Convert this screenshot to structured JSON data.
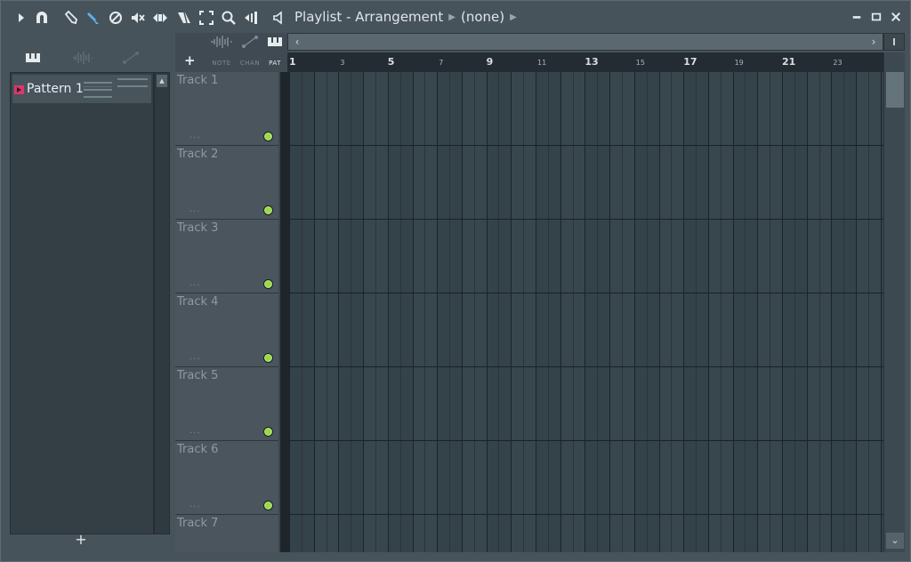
{
  "window": {
    "title": "Playlist - Arrangement",
    "context": "(none)"
  },
  "toolbar_icons": [
    "play-arrow-icon",
    "magnet-icon",
    "pencil-icon",
    "paint-brush-icon",
    "delete-icon",
    "mute-icon",
    "slip-icon",
    "slice-icon",
    "select-icon",
    "zoom-icon",
    "playback-icon",
    "speaker-icon"
  ],
  "patterns": {
    "items": [
      {
        "label": "Pattern 1",
        "color": "#e0356a"
      }
    ],
    "add_label": "+"
  },
  "playlist": {
    "add_label": "+",
    "modes": [
      {
        "label": "NOTE",
        "icon": "waveform-icon",
        "active": false
      },
      {
        "label": "CHAN",
        "icon": "automation-icon",
        "active": false
      },
      {
        "label": "PAT",
        "icon": "piano-icon",
        "active": true
      }
    ],
    "scroll_left": "‹",
    "scroll_right": "›",
    "timeline": {
      "major": [
        "1",
        "5",
        "9",
        "13",
        "17",
        "21"
      ],
      "minor": [
        "3",
        "7",
        "11",
        "15",
        "19",
        "23"
      ]
    },
    "tracks": [
      {
        "name": "Track 1",
        "dots": "..."
      },
      {
        "name": "Track 2",
        "dots": "..."
      },
      {
        "name": "Track 3",
        "dots": "..."
      },
      {
        "name": "Track 4",
        "dots": "..."
      },
      {
        "name": "Track 5",
        "dots": "..."
      },
      {
        "name": "Track 6",
        "dots": "..."
      },
      {
        "name": "Track 7",
        "dots": ""
      }
    ]
  },
  "colors": {
    "accent_led": "#9bd848",
    "active_tool": "#5fb0e8",
    "pattern_marker": "#e0356a"
  }
}
